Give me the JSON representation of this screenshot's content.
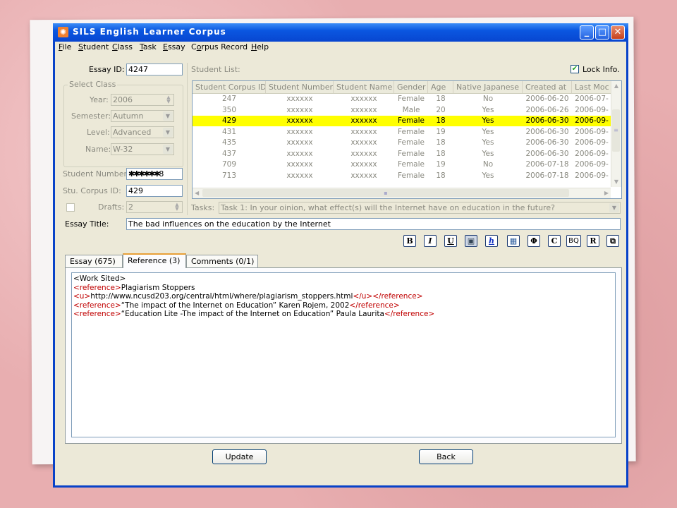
{
  "window": {
    "title": "SILS English Learner Corpus"
  },
  "menu": [
    {
      "accel": "F",
      "rest": "ile"
    },
    {
      "accel": "S",
      "rest": "tudent"
    },
    {
      "accel": "C",
      "rest": "lass"
    },
    {
      "accel": "T",
      "rest": "ask"
    },
    {
      "accel": "E",
      "rest": "ssay"
    },
    {
      "pre": "C",
      "accel": "o",
      "rest": "rpus Record"
    },
    {
      "accel": "H",
      "rest": "elp"
    }
  ],
  "form": {
    "essay_id_label": "Essay ID:",
    "essay_id": "4247",
    "select_class_label": "Select Class",
    "year_label": "Year:",
    "year": "2006",
    "semester_label": "Semester:",
    "semester": "Autumn",
    "level_label": "Level:",
    "level": "Advanced",
    "name_label": "Name:",
    "name": "W-32",
    "student_number_label": "Student Number:",
    "student_number_suffix": "8",
    "stu_corpus_id_label": "Stu. Corpus ID:",
    "stu_corpus_id": "429",
    "drafts_label": "Drafts:",
    "drafts": "2",
    "student_list_label": "Student List:",
    "lock_info_label": "Lock Info.",
    "tasks_label": "Tasks:",
    "task": "Task 1: In your oinion, what effect(s) will the Internet have on education in the future?",
    "essay_title_label": "Essay Title:",
    "essay_title": "The bad influences on the education by the Internet"
  },
  "table": {
    "columns": [
      "Student Corpus ID",
      "Student Number",
      "Student Name",
      "Gender",
      "Age",
      "Native Japanese",
      "Created at",
      "Last Moc"
    ],
    "rows": [
      [
        "247",
        "xxxxxx",
        "xxxxxx",
        "Female",
        "18",
        "No",
        "2006-06-20",
        "2006-07-"
      ],
      [
        "350",
        "xxxxxx",
        "xxxxxx",
        "Male",
        "20",
        "Yes",
        "2006-06-26",
        "2006-09-"
      ],
      [
        "429",
        "xxxxxx",
        "xxxxxx",
        "Female",
        "18",
        "Yes",
        "2006-06-30",
        "2006-09-"
      ],
      [
        "431",
        "xxxxxx",
        "xxxxxx",
        "Female",
        "19",
        "Yes",
        "2006-06-30",
        "2006-09-"
      ],
      [
        "435",
        "xxxxxx",
        "xxxxxx",
        "Female",
        "18",
        "Yes",
        "2006-06-30",
        "2006-09-"
      ],
      [
        "437",
        "xxxxxx",
        "xxxxxx",
        "Female",
        "18",
        "Yes",
        "2006-06-30",
        "2006-09-"
      ],
      [
        "709",
        "xxxxxx",
        "xxxxxx",
        "Female",
        "19",
        "No",
        "2006-07-18",
        "2006-09-"
      ],
      [
        "713",
        "xxxxxx",
        "xxxxxx",
        "Female",
        "18",
        "Yes",
        "2006-07-18",
        "2006-09-"
      ]
    ],
    "selected_row": 2
  },
  "toolbar": [
    "B",
    "I",
    "U",
    "img",
    "h",
    "table",
    "Φ",
    "C",
    "BQ",
    "R",
    "frame"
  ],
  "tabs": [
    "Essay (675)",
    "Reference (3)",
    "Comments (0/1)"
  ],
  "active_tab": 1,
  "reference": {
    "line1": "<Work Sited>",
    "l2_open": "<reference>",
    "l2_text": "Plagiarism Stoppers",
    "l3_open": "<u>",
    "l3_text": "http://www.ncusd203.org/central/html/where/plagiarism_stoppers.html",
    "l3_close": "</u></reference>",
    "l4_open": "<reference>",
    "l4_text": "“The impact of the Internet on Education” Karen Rojem, 2002",
    "l4_close": "</reference>",
    "l5_open": "<reference>",
    "l5_text": "“Education Lite -The impact of the Internet on Education” Paula Laurita",
    "l5_close": "</reference>"
  },
  "buttons": {
    "update": "Update",
    "back": "Back"
  }
}
